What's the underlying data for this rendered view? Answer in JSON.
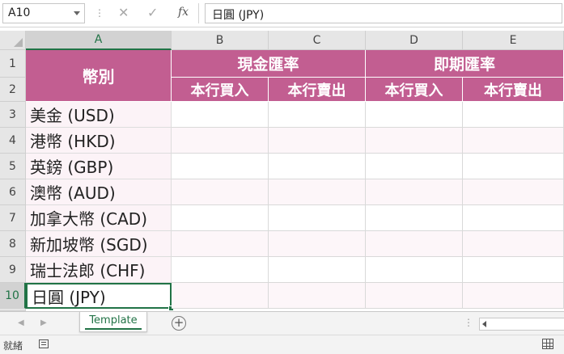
{
  "formula_bar": {
    "name_box": "A10",
    "cancel_icon": "✕",
    "enter_icon": "✓",
    "fx_label": "fx",
    "formula": "日圓 (JPY)"
  },
  "columns": [
    "A",
    "B",
    "C",
    "D",
    "E"
  ],
  "rows": [
    "1",
    "2",
    "3",
    "4",
    "5",
    "6",
    "7",
    "8",
    "9",
    "10"
  ],
  "header": {
    "currency": "幣別",
    "spot": "現金匯率",
    "forward": "即期匯率",
    "buy": "本行買入",
    "sell": "本行賣出"
  },
  "currencies": [
    "美金 (USD)",
    "港幣 (HKD)",
    "英鎊 (GBP)",
    "澳幣 (AUD)",
    "加拿大幣 (CAD)",
    "新加坡幣 (SGD)",
    "瑞士法郎 (CHF)",
    "日圓 (JPY)"
  ],
  "sheet_tab": "Template",
  "add_sheet": "+",
  "status": "就緒",
  "colors": {
    "header_fill": "#c25e91",
    "band_fill": "#fdf6f9",
    "accent": "#217346"
  },
  "icons": {
    "accessibility": "accessibility-icon",
    "normal_view": "normal-view-icon"
  }
}
